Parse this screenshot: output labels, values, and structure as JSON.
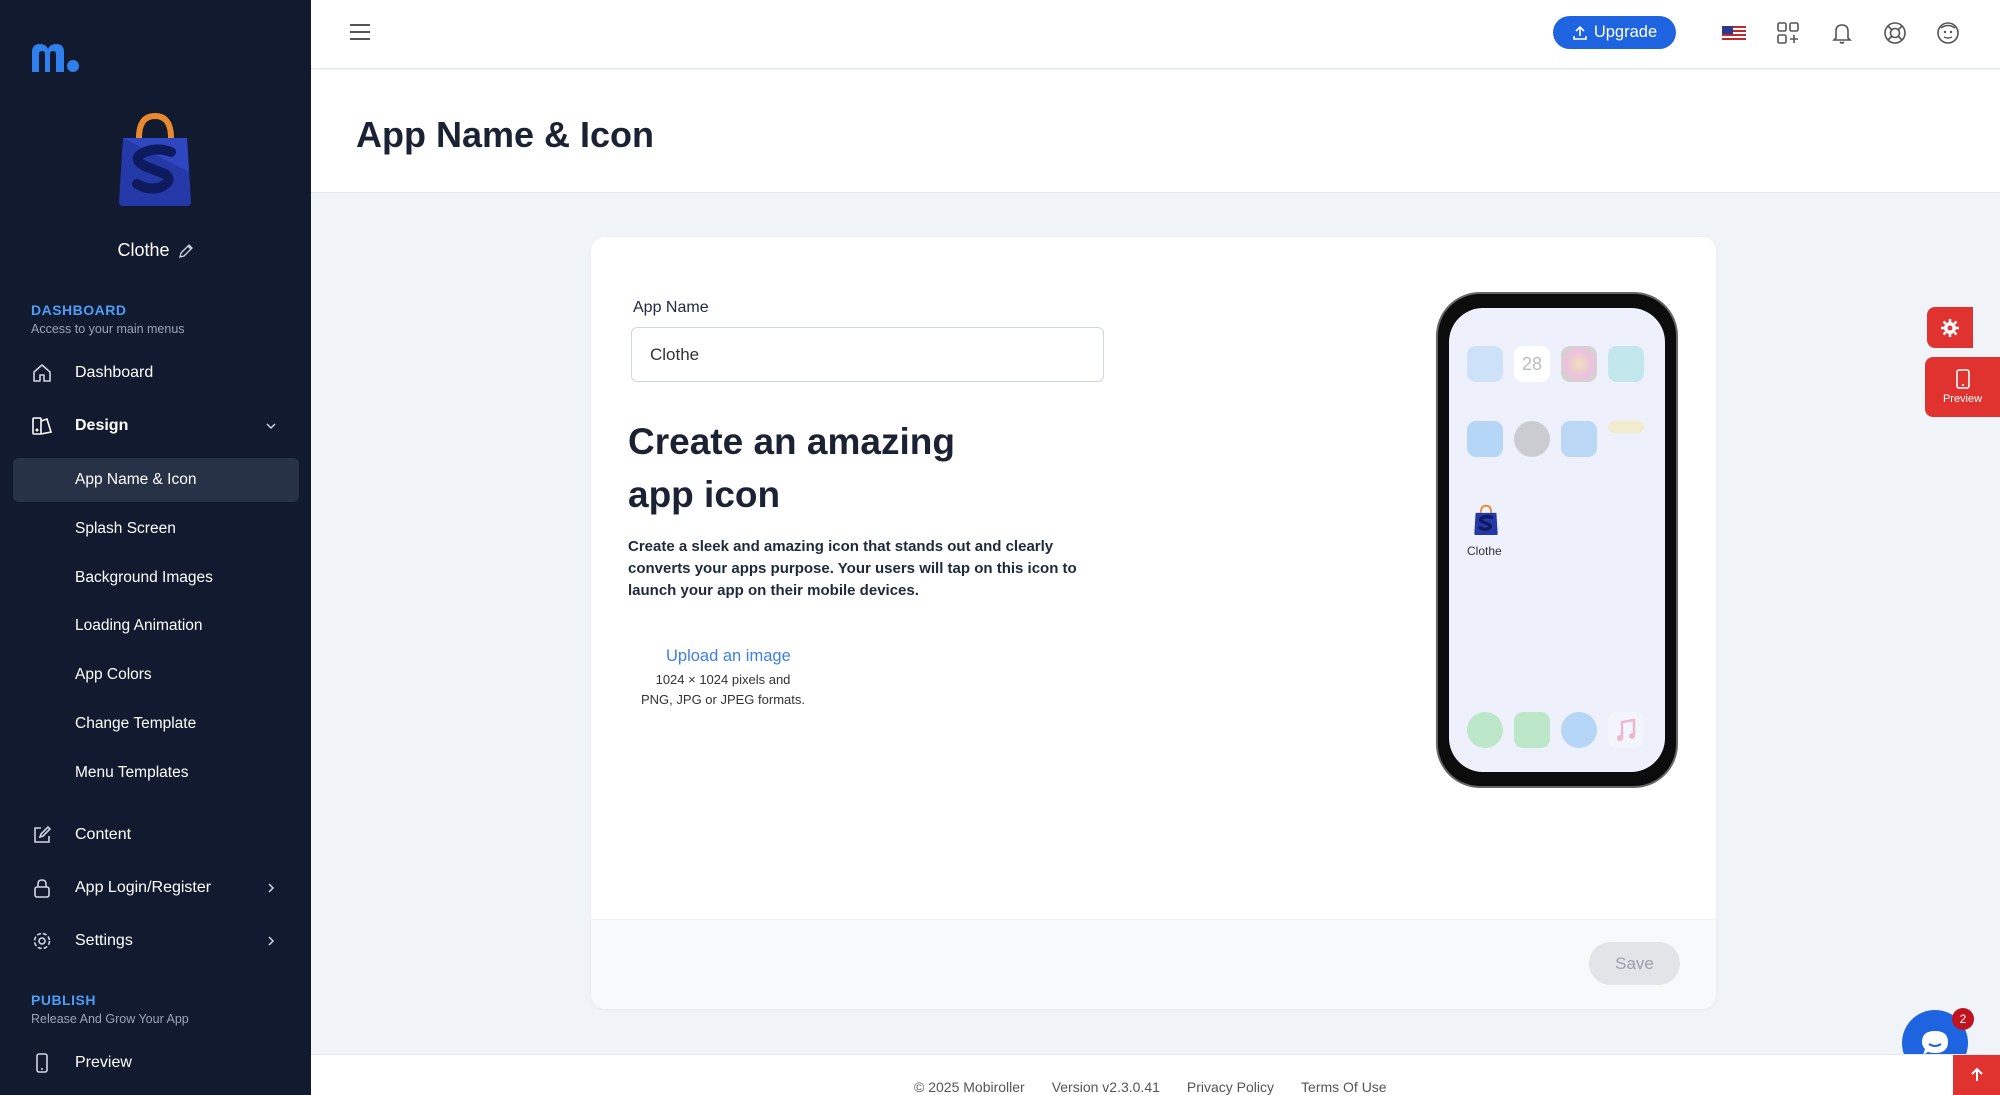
{
  "sidebar": {
    "app_name": "Clothe",
    "dashboard_title": "DASHBOARD",
    "dashboard_sub": "Access to your main menus",
    "items": {
      "dashboard": "Dashboard",
      "design": "Design",
      "content": "Content",
      "app_login": "App Login/Register",
      "settings": "Settings",
      "preview": "Preview"
    },
    "design_sub": [
      "App Name & Icon",
      "Splash Screen",
      "Background Images",
      "Loading Animation",
      "App Colors",
      "Change Template",
      "Menu Templates"
    ],
    "publish_title": "PUBLISH",
    "publish_sub": "Release And Grow Your App"
  },
  "topbar": {
    "upgrade_label": "Upgrade"
  },
  "page": {
    "title": "App Name & Icon"
  },
  "form": {
    "app_name_label": "App Name",
    "app_name_value": "Clothe",
    "headline": "Create an amazing app icon",
    "description": "Create a sleek and amazing icon that stands out and clearly converts your apps purpose. Your users will tap on this icon to launch your app on their mobile devices.",
    "upload_link": "Upload an image",
    "upload_hint_1": "1024 × 1024 pixels and",
    "upload_hint_2": "PNG, JPG or JPEG formats.",
    "save_label": "Save"
  },
  "phone": {
    "calendar_day": "28",
    "app_label": "Clothe"
  },
  "floating": {
    "preview_label": "Preview",
    "chat_badge": "2"
  },
  "footer": {
    "copyright": "© 2025 Mobiroller",
    "version": "Version v2.3.0.41",
    "privacy": "Privacy Policy",
    "terms": "Terms Of Use"
  },
  "colors": {
    "sidebar_bg": "#111a2e",
    "accent_blue": "#1e63e0",
    "section_blue": "#4d9ef7",
    "float_red": "#e0332f"
  }
}
